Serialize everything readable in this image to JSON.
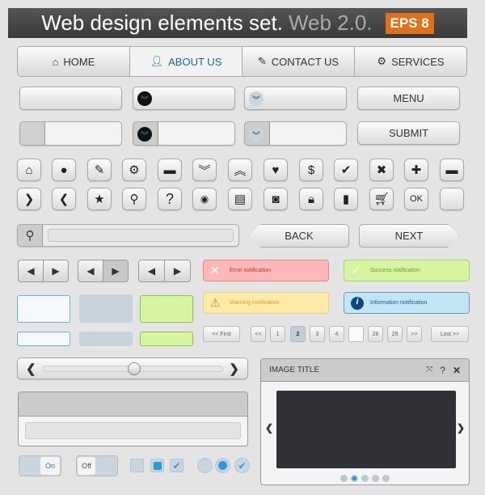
{
  "header": {
    "title": "Web design elements set.",
    "subtitle": "Web 2.0.",
    "badge": "EPS 8"
  },
  "nav": {
    "tabs": [
      {
        "label": "HOME",
        "icon": "home-icon"
      },
      {
        "label": "ABOUT US",
        "icon": "user-icon",
        "active": true
      },
      {
        "label": "CONTACT US",
        "icon": "pencil-icon"
      },
      {
        "label": "SERVICES",
        "icon": "gear-icon"
      }
    ]
  },
  "buttons": {
    "menu": "MENU",
    "submit": "SUBMIT",
    "back": "BACK",
    "next": "NEXT",
    "ok": "OK"
  },
  "notifications": {
    "error": "Error notification",
    "success": "Success notification",
    "warning": "Warning notification",
    "info": "Information notification"
  },
  "pagination": {
    "first": "<< First",
    "prev": "<<",
    "pages": [
      "1",
      "2",
      "3",
      "4",
      "",
      "28",
      "29"
    ],
    "current": "2",
    "next": ">>",
    "last": "Last >>"
  },
  "slider": {
    "value": 50
  },
  "toggles": {
    "on": "On",
    "off": "Off"
  },
  "image_panel": {
    "title": "IMAGE TITLE",
    "help": "?",
    "active_dot": 2,
    "dots": 5
  },
  "colors": {
    "accent": "#2a9ad8",
    "badge": "#e0701a",
    "error": "#ffb8b8",
    "success": "#d6f5a0",
    "warning": "#fde9a8",
    "info": "#c2e4f5"
  }
}
